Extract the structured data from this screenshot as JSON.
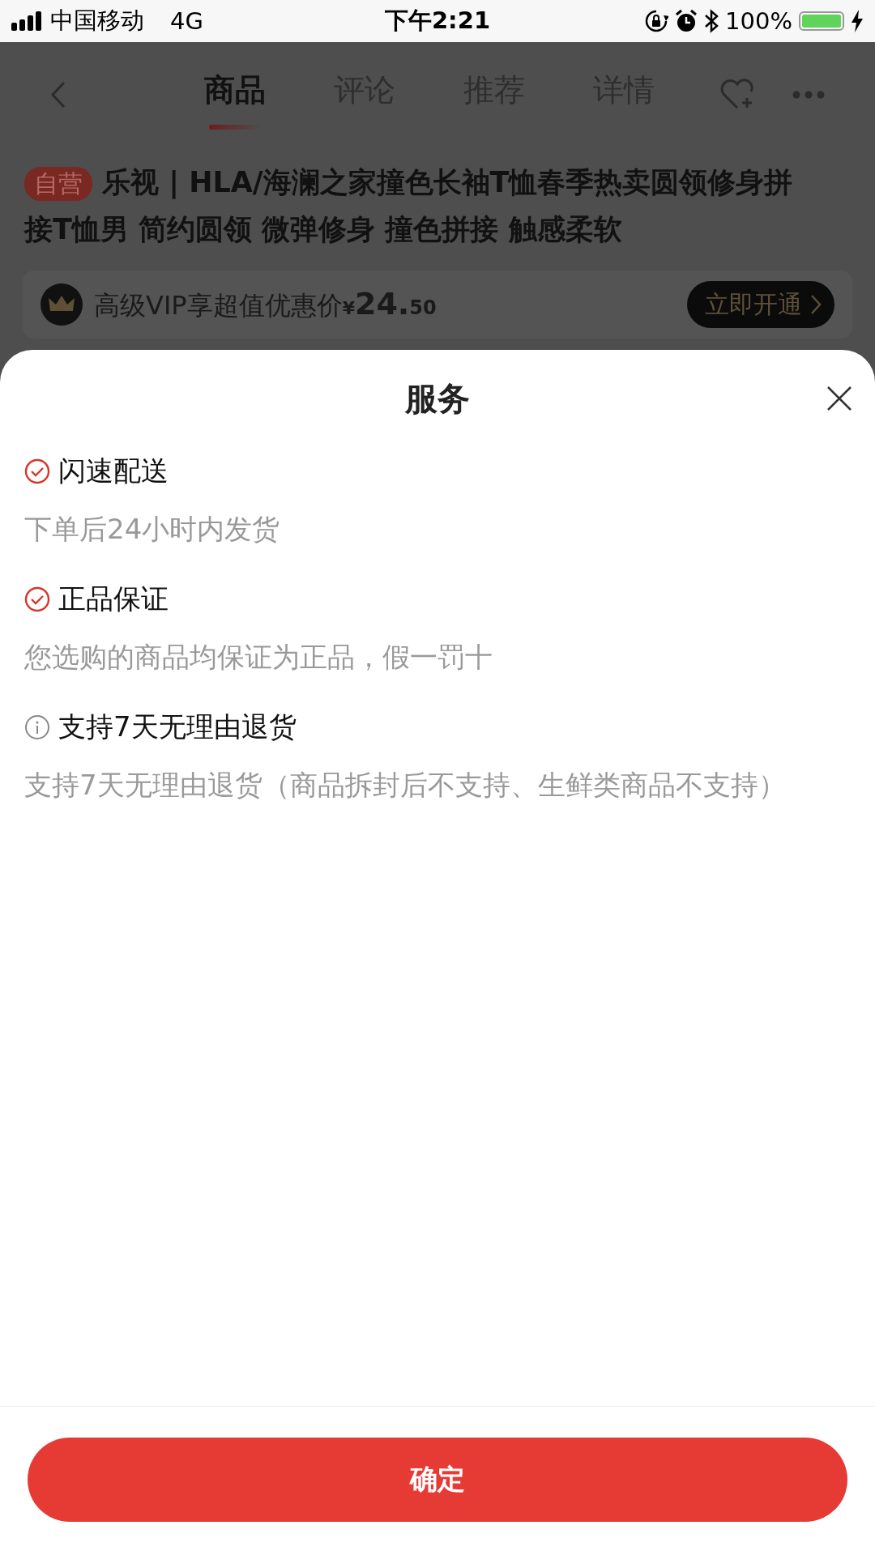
{
  "status_bar": {
    "carrier": "中国移动",
    "network": "4G",
    "time": "下午2:21",
    "battery": "100%"
  },
  "nav": {
    "tabs": [
      {
        "label": "商品",
        "selected": true
      },
      {
        "label": "评论",
        "selected": false
      },
      {
        "label": "推荐",
        "selected": false
      },
      {
        "label": "详情",
        "selected": false
      }
    ]
  },
  "product": {
    "badge": "自营",
    "title": "乐视 | HLA/海澜之家撞色长袖T恤春季热卖圆领修身拼接T恤男 简约圆领 微弹修身 撞色拼接 触感柔软"
  },
  "vip": {
    "text": "高级VIP享超值优惠价",
    "currency": "¥",
    "price_int": "24.",
    "price_dec": "50",
    "button": "立即开通"
  },
  "sheet": {
    "title": "服务",
    "items": [
      {
        "kind": "check",
        "title": "闪速配送",
        "desc": "下单后24小时内发货"
      },
      {
        "kind": "check",
        "title": "正品保证",
        "desc": "您选购的商品均保证为正品，假一罚十"
      },
      {
        "kind": "info",
        "title": "支持7天无理由退货",
        "desc": "支持7天无理由退货（商品拆封后不支持、生鲜类商品不支持）"
      }
    ],
    "confirm": "确定"
  }
}
